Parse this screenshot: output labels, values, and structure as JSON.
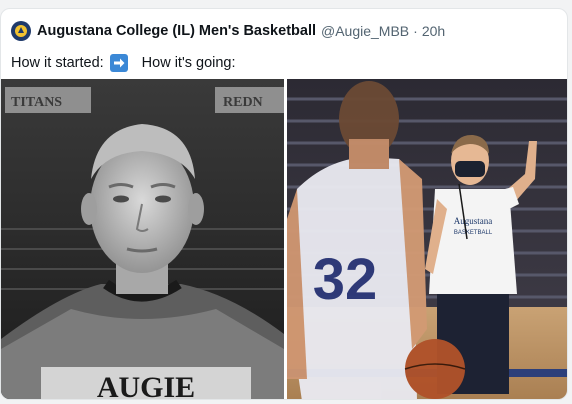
{
  "tweet": {
    "author_name": "Augustana College (IL) Men's Basketball",
    "handle": "@Augie_MBB",
    "separator": "·",
    "time": "20h",
    "text_part1": "How it started:",
    "text_part2": "How it's going:",
    "emoji": "right-arrow-emoji"
  },
  "media": {
    "left_photo": {
      "sign_left": "TITANS",
      "sign_right": "REDN",
      "shirt_text": "AUGIE"
    },
    "right_photo": {
      "jersey_number": "32",
      "shirt_logo_line1": "Augustana",
      "shirt_logo_line2": "BASKETBALL"
    }
  },
  "colors": {
    "name": "#0f1419",
    "secondary": "#536471",
    "avatar_bg": "#1f3a6b",
    "emoji_bg": "#3b88d6"
  }
}
